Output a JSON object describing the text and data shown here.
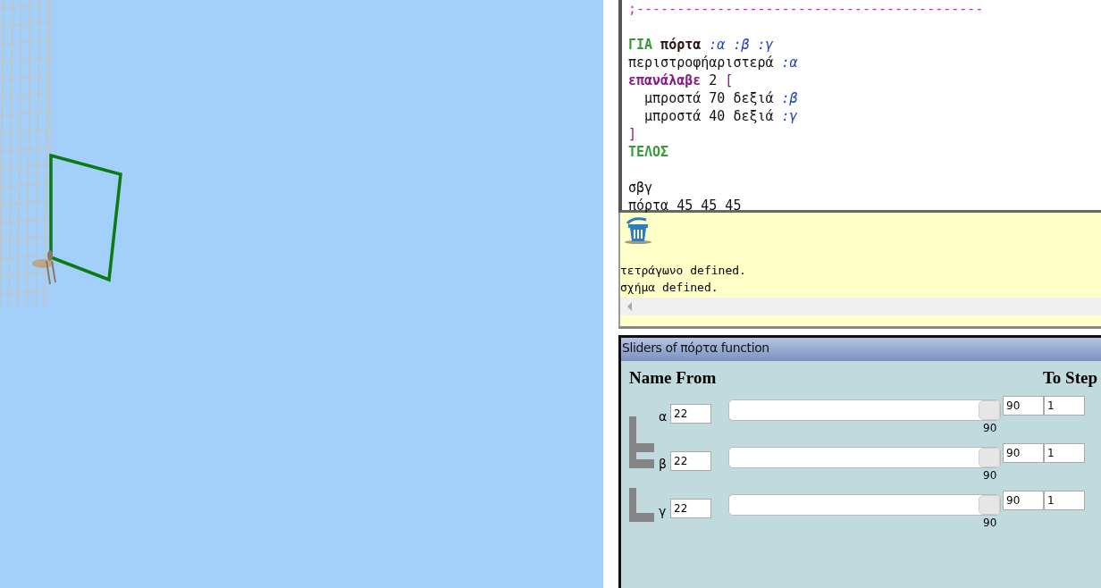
{
  "editor": {
    "lines": [
      {
        "gap_before": false,
        "tokens": [
          {
            "kind": "comment",
            "text": ";-------------------------------------------"
          }
        ]
      },
      {
        "gap_before": true,
        "tokens": [
          {
            "kind": "keyword",
            "text": "ΓΙΑ"
          },
          {
            "kind": "proc",
            "text": " πόρτα"
          },
          {
            "kind": "param",
            "text": " :α :β :γ"
          }
        ]
      },
      {
        "gap_before": false,
        "tokens": [
          {
            "kind": "plain",
            "text": "περιστροφήαριστερά"
          },
          {
            "kind": "param",
            "text": " :α"
          }
        ]
      },
      {
        "gap_before": false,
        "tokens": [
          {
            "kind": "control",
            "text": "επανάλαβε"
          },
          {
            "kind": "plain",
            "text": " 2"
          },
          {
            "kind": "bracket",
            "text": " ["
          }
        ]
      },
      {
        "gap_before": false,
        "tokens": [
          {
            "kind": "plain",
            "text": "  μπροστά 70 δεξιά"
          },
          {
            "kind": "param",
            "text": " :β"
          }
        ]
      },
      {
        "gap_before": false,
        "tokens": [
          {
            "kind": "plain",
            "text": "  μπροστά 40 δεξιά"
          },
          {
            "kind": "param",
            "text": " :γ"
          }
        ]
      },
      {
        "gap_before": false,
        "tokens": [
          {
            "kind": "bracket",
            "text": "]"
          }
        ]
      },
      {
        "gap_before": false,
        "tokens": [
          {
            "kind": "keyword",
            "text": "ΤΕΛΟΣ"
          }
        ]
      },
      {
        "gap_before": true,
        "tokens": [
          {
            "kind": "plain",
            "text": "σβγ"
          }
        ]
      },
      {
        "gap_before": false,
        "tokens": [
          {
            "kind": "plain",
            "text": "πόρτα 45 45 45"
          }
        ]
      }
    ]
  },
  "output": {
    "lines": [
      "τετράγωνο defined.",
      "σχήμα defined."
    ]
  },
  "sliders": {
    "title": "Sliders of πόρτα function",
    "headers": {
      "left": "Name From",
      "right": "To Step"
    },
    "rows": [
      {
        "name": "α",
        "from": "22",
        "level": 1,
        "reading": "90",
        "to": "90",
        "step": "1"
      },
      {
        "name": "β",
        "from": "22",
        "level": 1,
        "reading": "90",
        "to": "90",
        "step": "1"
      },
      {
        "name": "γ",
        "from": "22",
        "level": 1,
        "reading": "90",
        "to": "90",
        "step": "1"
      }
    ]
  }
}
